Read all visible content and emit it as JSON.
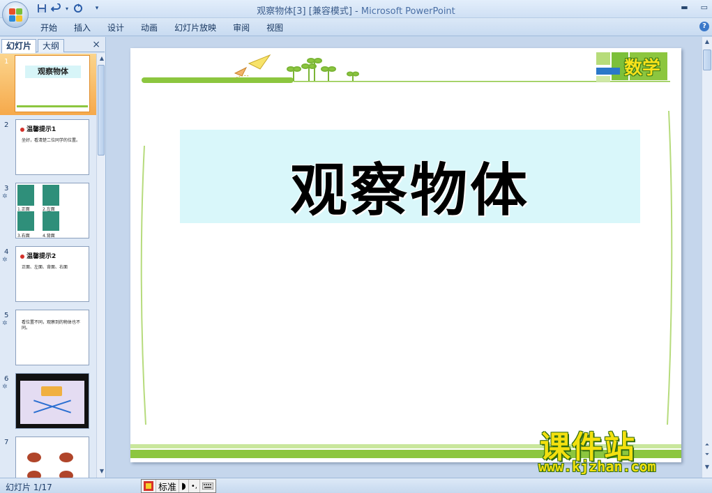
{
  "window": {
    "doc_title": "观察物体[3] [兼容模式]",
    "separator": " - ",
    "app_name": "Microsoft PowerPoint"
  },
  "qat": {
    "save_icon": "save-icon",
    "undo_icon": "undo-icon",
    "redo_icon": "redo-icon",
    "customize_icon": "customize-icon"
  },
  "ribbon": {
    "tabs": [
      "开始",
      "插入",
      "设计",
      "动画",
      "幻灯片放映",
      "审阅",
      "视图"
    ],
    "help_label": "?"
  },
  "pane": {
    "tabs": [
      "幻灯片",
      "大纲"
    ],
    "close_label": "×",
    "thumbnails": [
      {
        "num": "1",
        "title": "观察物体"
      },
      {
        "num": "2",
        "heading": "温馨提示1",
        "body": "坐好，看清楚二位同学的位置。"
      },
      {
        "num": "3",
        "labels": [
          "1.正面",
          "2.左面",
          "3.右面",
          "4.背面"
        ]
      },
      {
        "num": "4",
        "heading": "温馨提示2",
        "body": "正面、左面、背面、右面"
      },
      {
        "num": "5",
        "body": "看位置不同，观察到的物体也不同。"
      },
      {
        "num": "6"
      },
      {
        "num": "7"
      }
    ]
  },
  "slide": {
    "title": "观察物体",
    "subject_badge": "数学"
  },
  "status": {
    "slide_position": "幻灯片 1/17",
    "ime_mode": "标准"
  },
  "watermark": {
    "name": "课件站",
    "url": "www.kjzhan.com"
  },
  "colors": {
    "accent_green": "#8cc63f",
    "title_box": "#d9f7fa",
    "selection_orange": "#f6a94b"
  }
}
